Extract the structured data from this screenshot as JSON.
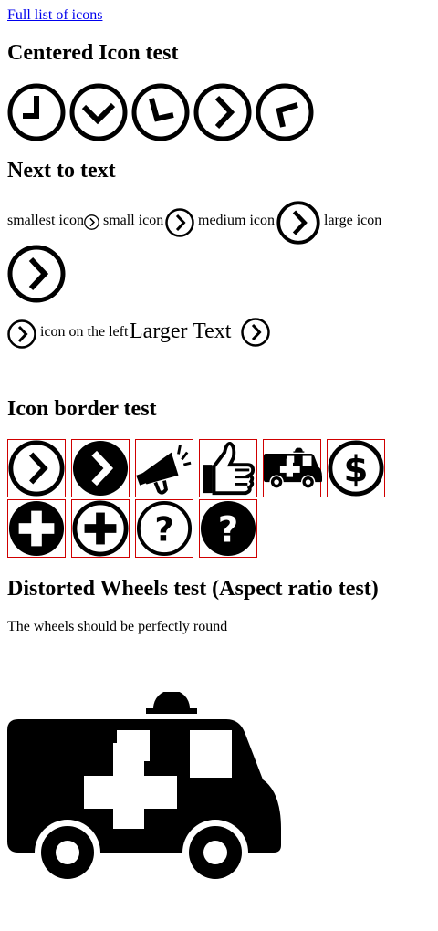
{
  "link": {
    "full_list": "Full list of icons"
  },
  "centered": {
    "heading": "Centered Icon test",
    "icons": [
      "clock-left-icon",
      "check-icon",
      "angle-down-left-icon",
      "chevron-right-icon",
      "angle-up-left-icon"
    ]
  },
  "next_to_text": {
    "heading": "Next to text",
    "smallest_label": "smallest icon",
    "small_label": "small icon",
    "medium_label": "medium icon",
    "large_label": "large icon",
    "left_label": "icon on the left",
    "larger_text": "Larger Text"
  },
  "border_test": {
    "heading": "Icon border test",
    "icons": [
      "chevron-right-circle-outline-icon",
      "chevron-right-circle-filled-icon",
      "megaphone-icon",
      "thumbs-up-icon",
      "ambulance-icon",
      "dollar-circle-icon",
      "plus-circle-filled-icon",
      "plus-circle-outline-icon",
      "question-circle-outline-icon",
      "question-circle-filled-icon"
    ],
    "border_color": "#d00000"
  },
  "wheels": {
    "heading": "Distorted Wheels test (Aspect ratio test)",
    "note": "The wheels should be perfectly round",
    "icon": "ambulance-icon"
  }
}
